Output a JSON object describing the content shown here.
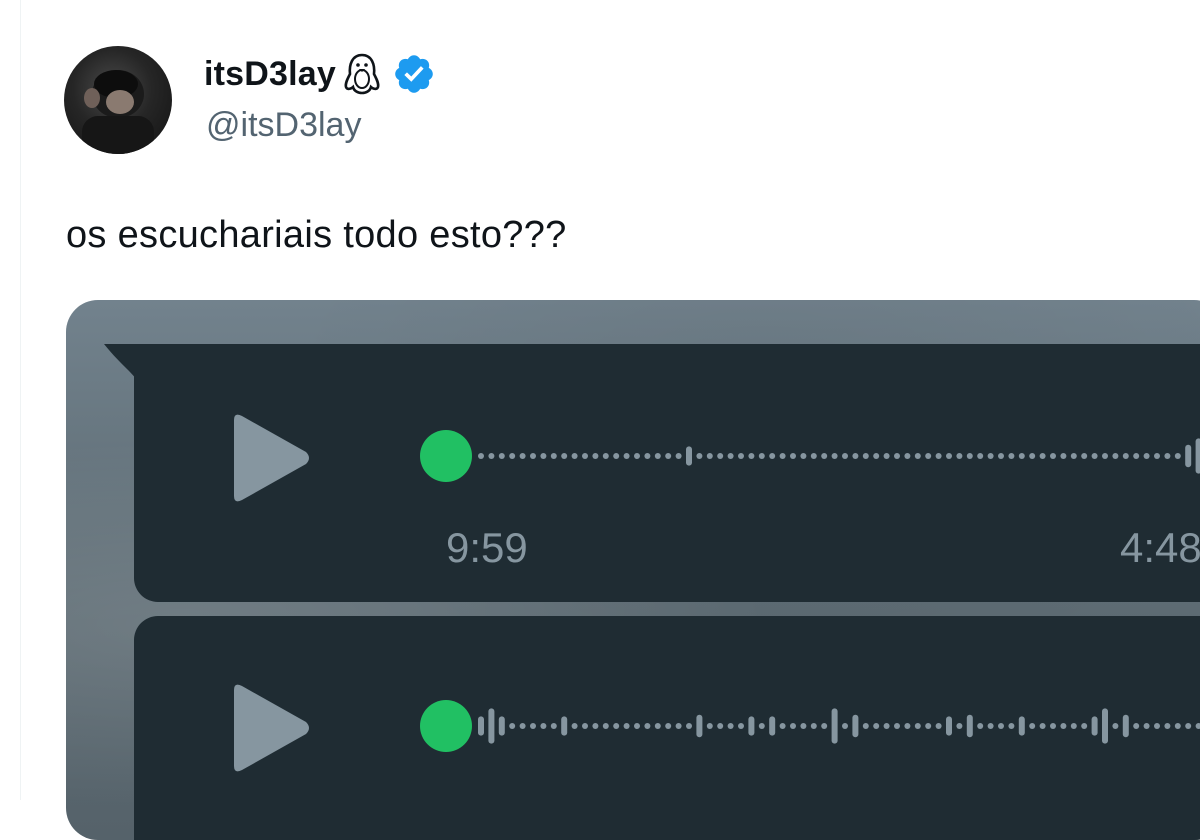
{
  "author": {
    "display_name": "itsD3lay",
    "emoji_icon": "penguin-icon",
    "verified_icon": "verified-badge-icon",
    "handle": "@itsD3lay"
  },
  "tweet": {
    "text": "os escuchariais todo esto???"
  },
  "voice_messages": [
    {
      "duration": "9:59",
      "time_sent": "4:48",
      "progress": 0
    },
    {
      "progress": 0
    }
  ],
  "colors": {
    "accent_green": "#21c063",
    "bubble_bg": "#1f2c33",
    "muted_text": "#8696a0",
    "verified_blue": "#1d9bf0"
  }
}
